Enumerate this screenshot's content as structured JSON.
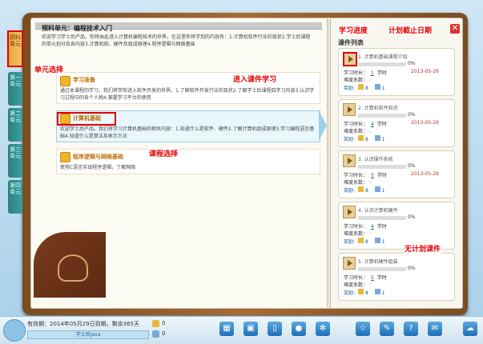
{
  "left": {
    "unit_title": "预科单元：编程技术入门",
    "unit_desc": "欢迎学习学士后产品，你将由此进入计算机编程技术的世界，在这里你将学到的内容有：1.计算机软件行业的现状2.学士后课程的单元划分及各内容3.计算机软、硬件及组成原理4.程序逻辑与网络基础",
    "courses": [
      {
        "title": "学习准备",
        "desc": "通过本课程的学习，我们将带你进入软件开发的世界。1.了解软件开发行业的现状2.了解学士后课程四学习内容3.认识学习过程中的各个人物4.掌握学习平台的使用"
      },
      {
        "title": "计算机基础",
        "desc": "欢迎学士后产品。我们将学习计算机基础的相关内容：1.知道什么是软件、硬件2.了解计算机组成原理3.学习编程语言基础4.知道什么是算法及表示方法"
      },
      {
        "title": "程序逻辑与网络基础",
        "desc": "使用C语言实现程序逻辑，了解网络"
      }
    ]
  },
  "tabs": [
    "预科单元",
    "第一单元",
    "第二单元",
    "第三单元",
    "第四单元"
  ],
  "right": {
    "header": "课件列表",
    "study_time_label": "学习时长：",
    "difficulty_label": "难度系数：",
    "reward_label": "奖励:",
    "hour_unit": "学时",
    "cards": [
      {
        "title": "1. 计算机基础课程介绍",
        "progress": "0%",
        "hours": "1",
        "due": "2013-05-29",
        "coins": "8",
        "books": "1",
        "progress_value": 0
      },
      {
        "title": "2. 计算机软件知识",
        "progress": "0%",
        "hours": "4",
        "due": "2013-05-29",
        "coins": "8",
        "books": "1",
        "progress_value": 0
      },
      {
        "title": "3. 认识操作系统",
        "progress": "0%",
        "hours": "5",
        "due": "2013-05-29",
        "coins": "8",
        "books": "1",
        "progress_value": 0
      },
      {
        "title": "4. 认识计算机硬件",
        "progress": "0%",
        "hours": "4",
        "due": "",
        "coins": "8",
        "books": "1",
        "progress_value": 0
      },
      {
        "title": "5. 计算机硬件组装",
        "progress": "0%",
        "hours": "5",
        "due": "",
        "coins": "8",
        "books": "1",
        "progress_value": 0
      }
    ]
  },
  "annotations": {
    "unit_select": "单元选择",
    "enter_course": "进入课件学习",
    "course_select": "课程选择",
    "progress": "学习进度",
    "deadline": "计划截止日期",
    "no_plan": "无计划课件"
  },
  "bottom": {
    "expiry": "有效期：2014年05月29日到期，剩余365天",
    "user": "学士后java",
    "count1": "0",
    "count2": "0"
  }
}
